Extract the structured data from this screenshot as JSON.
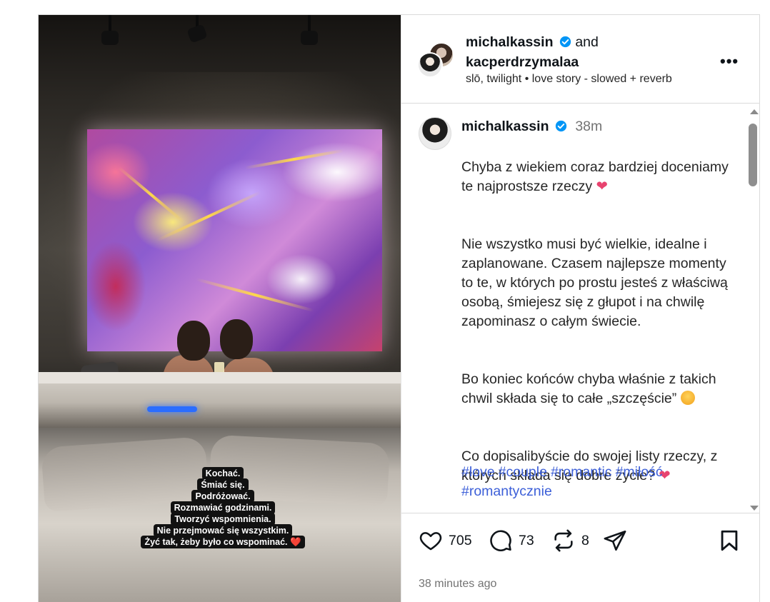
{
  "post": {
    "authors": {
      "primary": "michalkassin",
      "joiner": "and",
      "secondary": "kacperdrzymalaa"
    },
    "music": "slō, twilight • love story - slowed + reverb",
    "more_label": "•••",
    "caption_overlay": [
      "Kochać.",
      "Śmiać się.",
      "Podróżować.",
      "Rozmawiać godzinami.",
      "Tworzyć wspomnienia.",
      "Nie przejmować się wszystkim.",
      "Żyć tak, żeby było co wspominać. ❤️"
    ],
    "comment": {
      "author": "michalkassin",
      "time": "38m",
      "paragraphs": [
        "Chyba z wiekiem coraz bardziej doceniamy te najprostsze rzeczy",
        "Nie wszystko musi być wielkie, idealne i zaplanowane. Czasem najlepsze momenty to te, w których po prostu jesteś z właściwą osobą, śmiejesz się z głupot i na chwilę zapominasz o całym świecie.",
        "Bo koniec końców chyba właśnie z takich chwil składa się to całe „szczęście”",
        "Co dopisalibyście do swojej listy rzeczy, z których składa się dobre życie?"
      ],
      "hashtags": [
        "#love",
        "#couple",
        "#romantic",
        "#miłość",
        "#romantycznie"
      ]
    },
    "stats": {
      "likes": "705",
      "comments": "73",
      "reposts": "8"
    },
    "timestamp": "38 minutes ago",
    "colors": {
      "verified": "#0095f6",
      "hashtag": "#3c5fd8",
      "muted": "#737373"
    }
  }
}
